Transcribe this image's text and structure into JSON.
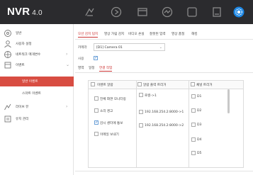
{
  "app": {
    "brand": "NVR",
    "version": "4.0"
  },
  "topnav": [
    {
      "icon": "live-view-icon",
      "active": false
    },
    {
      "icon": "playback-icon",
      "active": false
    },
    {
      "icon": "file-icon",
      "active": false
    },
    {
      "icon": "analytics-icon",
      "active": false
    },
    {
      "icon": "backup-icon",
      "active": false
    },
    {
      "icon": "storage-icon",
      "active": false
    },
    {
      "icon": "settings-gear-icon",
      "active": true
    }
  ],
  "colors": {
    "topbar": "#2b2b2e",
    "accent": "#d84d42",
    "active_icon": "#1e88e5"
  },
  "sidebar": {
    "items": [
      {
        "label": "일반",
        "icon": "general-icon"
      },
      {
        "label": "사용자 설정",
        "icon": "user-icon"
      },
      {
        "label": "네트워크 매개변수",
        "icon": "network-icon"
      },
      {
        "label": "이벤트",
        "icon": "event-icon"
      },
      {
        "label": "라이브 뷰",
        "icon": "live-view-icon"
      },
      {
        "label": "유지 관리",
        "icon": "maintenance-icon"
      }
    ],
    "subitems": [
      {
        "label": "일반 이벤트",
        "active": true
      },
      {
        "label": "스마트 이벤트",
        "active": false
      }
    ]
  },
  "tabs": [
    "모션 감지 탐지",
    "영상 가림 감지",
    "비디오 손실",
    "잘못된 입력",
    "영상 품질",
    "해킹"
  ],
  "form": {
    "camera_label": "카메라",
    "camera_value": "[D1] Camera 01",
    "enable_label": "사용"
  },
  "subtabs": [
    "영역",
    "일정",
    "연결 작업"
  ],
  "table": {
    "headers": [
      "이벤트 알람",
      "알람 출력 트리거",
      "채널 트리거"
    ],
    "col1": [
      {
        "label": "전체 화면 모니터링",
        "checked": false
      },
      {
        "label": "소리 경고",
        "checked": false
      },
      {
        "label": "감시 센터에 통보",
        "checked": true
      },
      {
        "label": "이메일 보내기",
        "checked": false
      }
    ],
    "col2": [
      "로컬->1",
      "192.168.254.2:8000->1",
      "192.168.254.2:8000->2"
    ],
    "col3": [
      "D1",
      "D2",
      "D3",
      "D4",
      "D5"
    ]
  }
}
